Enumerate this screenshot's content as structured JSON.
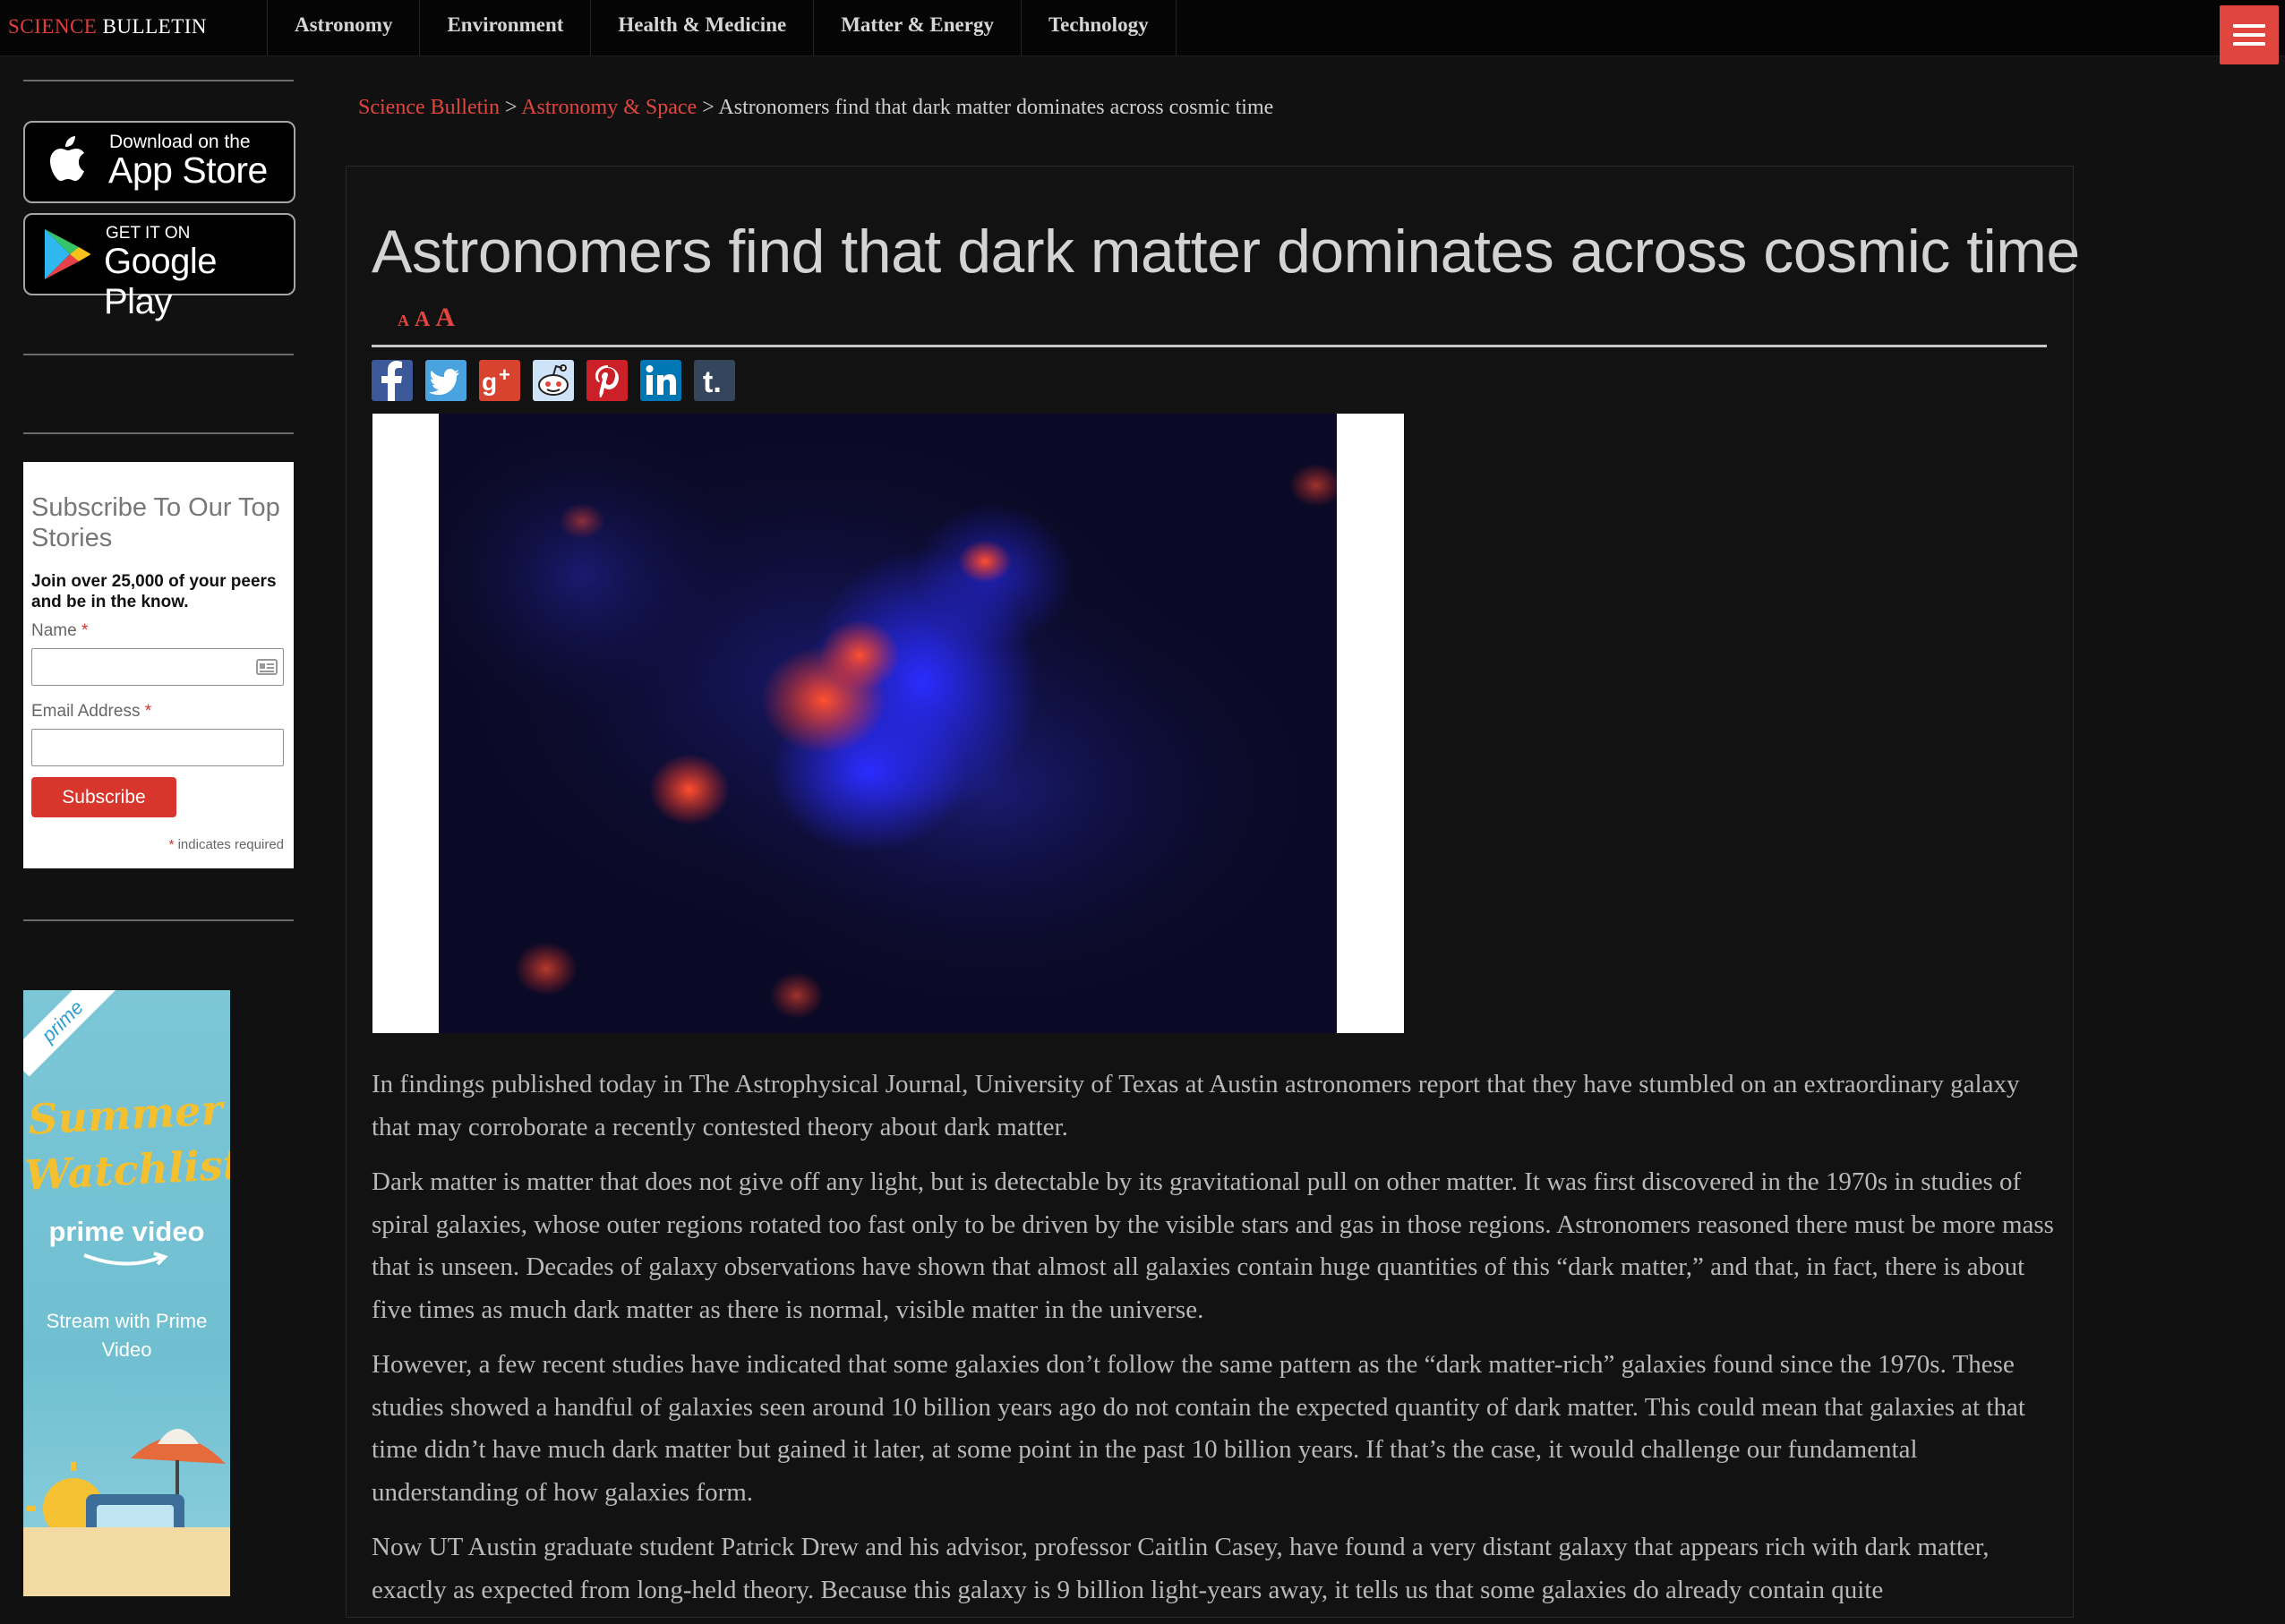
{
  "brand": {
    "part1": "SCIENCE",
    "part2": "BULLETIN"
  },
  "nav": [
    "Astronomy",
    "Environment",
    "Health & Medicine",
    "Matter & Energy",
    "Technology"
  ],
  "sidebar": {
    "app_store": {
      "small": "Download on the",
      "big": "App Store"
    },
    "google_play": {
      "small": "GET IT ON",
      "big": "Google Play"
    },
    "subscribe": {
      "title": "Subscribe To Our Top Stories",
      "subtitle": "Join over 25,000 of your peers and be in the know.",
      "name_label": "Name",
      "email_label": "Email Address",
      "required_mark": "*",
      "button": "Subscribe",
      "required_note": "indicates required"
    },
    "ad": {
      "badge": "prime",
      "title": "Summer Watchlist",
      "logo": "prime video",
      "tagline": "Stream with Prime Video"
    }
  },
  "breadcrumb": {
    "home": "Science Bulletin",
    "sep": ">",
    "section": "Astronomy & Space",
    "current": "Astronomers find that dark matter dominates across cosmic time"
  },
  "article": {
    "title": "Astronomers find that dark matter dominates across cosmic time",
    "font_sizes": [
      "A",
      "A",
      "A"
    ],
    "share": [
      "facebook-icon",
      "twitter-icon",
      "google-plus-icon",
      "reddit-icon",
      "pinterest-icon",
      "linkedin-icon",
      "tumblr-icon"
    ],
    "paragraphs": [
      "In findings published today in The Astrophysical Journal, University of Texas at Austin astronomers report that they have stumbled on an extraordinary galaxy that may corroborate a recently contested theory about dark matter.",
      "Dark matter is matter that does not give off any light, but is detectable by its gravitational pull on other matter. It was first discovered in the 1970s in studies of spiral galaxies, whose outer regions rotated too fast only to be driven by the visible stars and gas in those regions. Astronomers reasoned there must be more mass that is unseen. Decades of galaxy observations have shown that almost all galaxies contain huge quantities of this “dark matter,” and that, in fact, there is about five times as much dark matter as there is normal, visible matter in the universe.",
      "However, a few recent studies have indicated that some galaxies don’t follow the same pattern as the “dark matter-rich” galaxies found since the 1970s. These studies showed a handful of galaxies seen around 10 billion years ago do not contain the expected quantity of dark matter. This could mean that galaxies at that time didn’t have much dark matter but gained it later, at some point in the past 10 billion years. If that’s the case, it would challenge our fundamental understanding of how galaxies form.",
      "Now UT Austin graduate student Patrick Drew and his advisor, professor Caitlin Casey, have found a very distant galaxy that appears rich with dark matter, exactly as expected from long-held theory. Because this galaxy is 9 billion light-years away, it tells us that some galaxies do already contain quite"
    ]
  },
  "colors": {
    "accent": "#e0463e",
    "background": "#111111",
    "text": "#b9b9b9"
  }
}
